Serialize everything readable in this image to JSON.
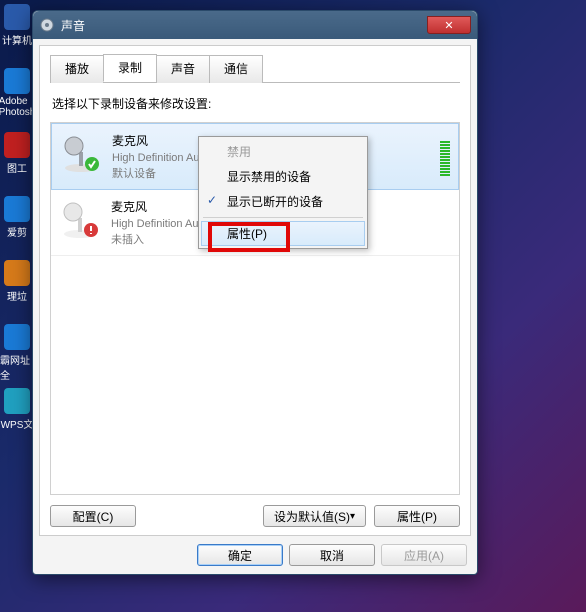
{
  "desktop": {
    "items": [
      {
        "label": "计算机"
      },
      {
        "label": "Adobe Photosh"
      },
      {
        "label": "图工"
      },
      {
        "label": "爱剪"
      },
      {
        "label": "理垃"
      },
      {
        "label": "霸网址 全"
      },
      {
        "label": "WPS文"
      }
    ]
  },
  "window": {
    "title": "声音",
    "close_glyph": "✕"
  },
  "tabs": [
    {
      "label": "播放"
    },
    {
      "label": "录制"
    },
    {
      "label": "声音"
    },
    {
      "label": "通信"
    }
  ],
  "active_tab_index": 1,
  "instruction": "选择以下录制设备来修改设置:",
  "devices": [
    {
      "name": "麦克风",
      "desc": "High Definition Audio 设备",
      "status": "默认设备",
      "state": "ok",
      "selected": true
    },
    {
      "name": "麦克风",
      "desc": "High Definition Audio 设备",
      "status": "未插入",
      "state": "unplugged",
      "selected": false
    }
  ],
  "context_menu": {
    "items": [
      {
        "label": "禁用",
        "disabled": true
      },
      {
        "label": "显示禁用的设备"
      },
      {
        "label": "显示已断开的设备",
        "checked": true
      },
      {
        "sep": true
      },
      {
        "label": "属性(P)",
        "hover": true
      }
    ]
  },
  "buttons": {
    "configure": "配置(C)",
    "set_default": "设为默认值(S)",
    "properties": "属性(P)"
  },
  "footer": {
    "ok": "确定",
    "cancel": "取消",
    "apply": "应用(A)"
  }
}
